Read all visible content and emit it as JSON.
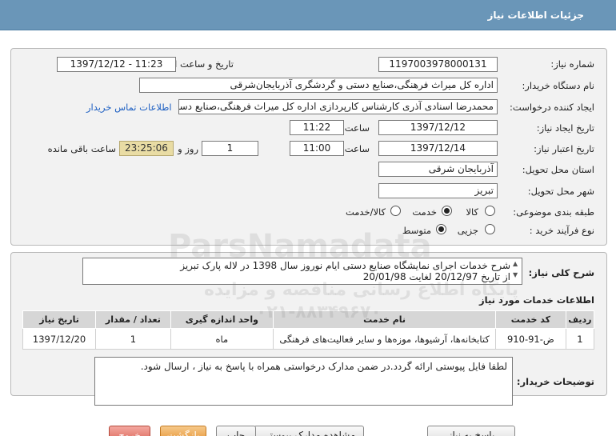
{
  "header": {
    "title": "جزئیات اطلاعات نیاز"
  },
  "form": {
    "need_number_label": "شماره نیاز:",
    "need_number": "1197003978000131",
    "announce_label": "تاریخ و ساعت اعلان عمومی:",
    "announce_value": "1397/12/12 - 11:23",
    "buyer_org_label": "نام دستگاه خریدار:",
    "buyer_org": "اداره کل میراث فرهنگی،صنایع دستی و گردشگری آذربایجان‌شرقی",
    "requester_label": "ایجاد کننده درخواست:",
    "requester": "محمدرضا اسنادی آذری کارشناس کارپردازی اداره کل میراث فرهنگی،صنایع دستی و گردشگری",
    "contact_link": "اطلاعات تماس خریدار",
    "created_label": "تاریخ ایجاد نیاز:",
    "created_date": "1397/12/12",
    "created_time_label": "ساعت",
    "created_time": "11:22",
    "valid_label": "تاریخ اعتبار نیاز:",
    "valid_date": "1397/12/14",
    "valid_time_label": "ساعت",
    "valid_time": "11:00",
    "days_value": "1",
    "days_label": "روز و",
    "remaining_time": "23:25:06",
    "remaining_label": "ساعت باقی مانده",
    "province_label": "استان محل تحویل:",
    "province": "آذربایجان شرقی",
    "city_label": "شهر محل تحویل:",
    "city": "تبریز",
    "category_label": "طبقه بندی موضوعی:",
    "category_options": [
      "کالا",
      "خدمت",
      "کالا/خدمت"
    ],
    "category_selected": "خدمت",
    "process_label": "نوع فرآیند خرید :",
    "process_options": [
      "جزیی",
      "متوسط"
    ],
    "process_selected": "متوسط"
  },
  "summary": {
    "label": "شرح کلی نیاز:",
    "line1": "شرح خدمات اجرای نمایشگاه صنایع دستی ایام نوروز سال 1398 در لاله پارک تبریز",
    "line2": "از تاریخ 20/12/97 لغایت 20/01/98"
  },
  "services": {
    "section_title": "اطلاعات خدمات مورد نیاز",
    "columns": [
      "ردیف",
      "کد خدمت",
      "نام خدمت",
      "واحد اندازه گیری",
      "تعداد / مقدار",
      "تاریخ نیاز"
    ],
    "rows": [
      [
        "1",
        "ض-91-910",
        "کتابخانه‌ها، آرشیوها، موزه‌ها و سایر فعالیت‌های فرهنگی",
        "ماه",
        "1",
        "1397/12/20"
      ]
    ]
  },
  "notes": {
    "label": "توضیحات خریدار:",
    "text": "لطفا فایل پیوستی ارائه گردد.در ضمن مدارک درخواستی همراه با پاسخ به نیاز ، ارسال شود."
  },
  "buttons": {
    "respond": "پاسخ به نیاز",
    "attachments": "مشاهده مدارک پیوستی (1)",
    "print": "چاپ",
    "back": "بازگشت",
    "exit": "خروج"
  },
  "watermark": {
    "brand": "ParsNamadata",
    "line1": "پایگاه اطلاع رسانی مناقصه و مزایده",
    "line2": "۰۲۱-۸۸۳۴۹۶۷۰"
  }
}
